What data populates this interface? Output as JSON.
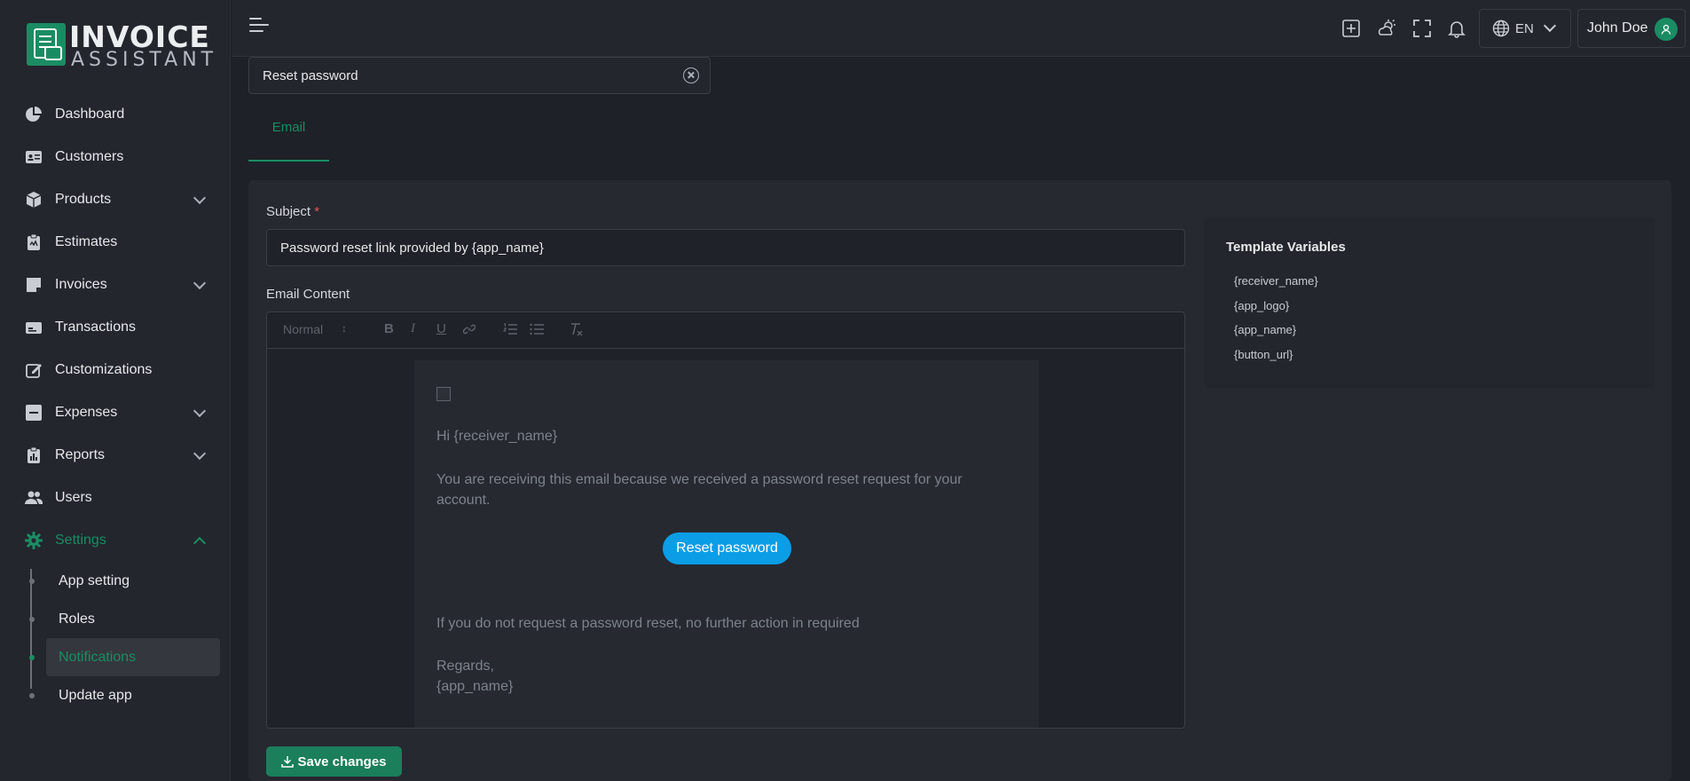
{
  "brand": {
    "line1": "INVOICE",
    "line2": "ASSISTANT",
    "accent": "#1a8c63"
  },
  "sidebar": {
    "items": [
      {
        "label": "Dashboard",
        "icon": "pie-chart-icon"
      },
      {
        "label": "Customers",
        "icon": "id-card-icon"
      },
      {
        "label": "Products",
        "icon": "box-icon",
        "expandable": true
      },
      {
        "label": "Estimates",
        "icon": "clipboard-icon"
      },
      {
        "label": "Invoices",
        "icon": "sticky-note-icon",
        "expandable": true
      },
      {
        "label": "Transactions",
        "icon": "money-icon"
      },
      {
        "label": "Customizations",
        "icon": "edit-icon"
      },
      {
        "label": "Expenses",
        "icon": "minus-square-icon",
        "expandable": true
      },
      {
        "label": "Reports",
        "icon": "report-icon",
        "expandable": true
      },
      {
        "label": "Users",
        "icon": "users-icon"
      },
      {
        "label": "Settings",
        "icon": "gear-icon",
        "expanded": true,
        "active": true
      }
    ],
    "settings_sub": [
      {
        "label": "App setting"
      },
      {
        "label": "Roles"
      },
      {
        "label": "Notifications",
        "active": true
      },
      {
        "label": "Update app"
      }
    ]
  },
  "topbar": {
    "icons": [
      "add-square-icon",
      "weather-icon",
      "fullscreen-icon",
      "bell-icon"
    ],
    "language": "EN",
    "user_name": "John Doe"
  },
  "template_select": {
    "value": "Reset password"
  },
  "tabs": [
    {
      "label": "Email",
      "active": true
    }
  ],
  "form": {
    "subject_label": "Subject",
    "subject_required": "*",
    "subject_value": "Password reset link provided by {app_name}",
    "content_label": "Email Content",
    "toolbar": {
      "format": "Normal",
      "buttons": [
        "B",
        "I",
        "U"
      ]
    },
    "email": {
      "greeting": "Hi {receiver_name}",
      "body1": "You are receiving this email because we received a password reset request for your",
      "body2": "account.",
      "button": "Reset password",
      "footer": "If you do not request a password reset, no further action in required",
      "regards": "Regards,",
      "signature": "{app_name}"
    },
    "save_label": "Save changes"
  },
  "variables": {
    "title": "Template Variables",
    "items": [
      "{receiver_name}",
      "{app_logo}",
      "{app_name}",
      "{button_url}"
    ]
  }
}
